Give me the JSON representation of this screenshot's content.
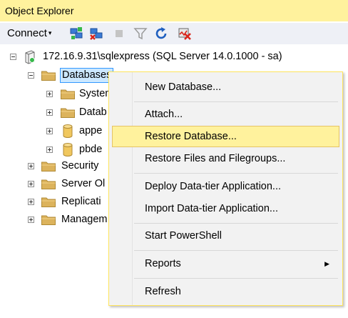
{
  "panel": {
    "title": "Object Explorer"
  },
  "toolbar": {
    "connect_label": "Connect",
    "connect_caret": "▾",
    "icons": [
      "connect-object-explorer-icon",
      "disconnect-icon",
      "stop-icon",
      "filter-icon",
      "refresh-icon",
      "activity-monitor-icon"
    ]
  },
  "tree": {
    "server": {
      "label": "172.16.9.31\\sqlexpress (SQL Server 14.0.1000 - sa)",
      "expanded": true
    },
    "databases": {
      "label": "Databases",
      "expanded": true,
      "selected": true
    },
    "db_children": [
      "System",
      "Datab",
      "appe",
      "pbde"
    ],
    "server_children": [
      "Security",
      "Server Ol",
      "Replicati",
      "Managem"
    ]
  },
  "context_menu": {
    "items": [
      {
        "label": "New Database..."
      },
      {
        "label": "Attach..."
      },
      {
        "label": "Restore Database...",
        "highlighted": true
      },
      {
        "label": "Restore Files and Filegroups..."
      },
      {
        "label": "Deploy Data-tier Application..."
      },
      {
        "label": "Import Data-tier Application..."
      },
      {
        "label": "Start PowerShell"
      },
      {
        "label": "Reports",
        "submenu_arrow": "▶"
      },
      {
        "label": "Refresh"
      }
    ]
  },
  "colors": {
    "title_bar": "#fff29d",
    "toolbar": "#eef0f6",
    "selection": "#cce8ff",
    "selection_border": "#3399ff",
    "menu_highlight": "#fff29d",
    "folder": "#dcb35c"
  }
}
